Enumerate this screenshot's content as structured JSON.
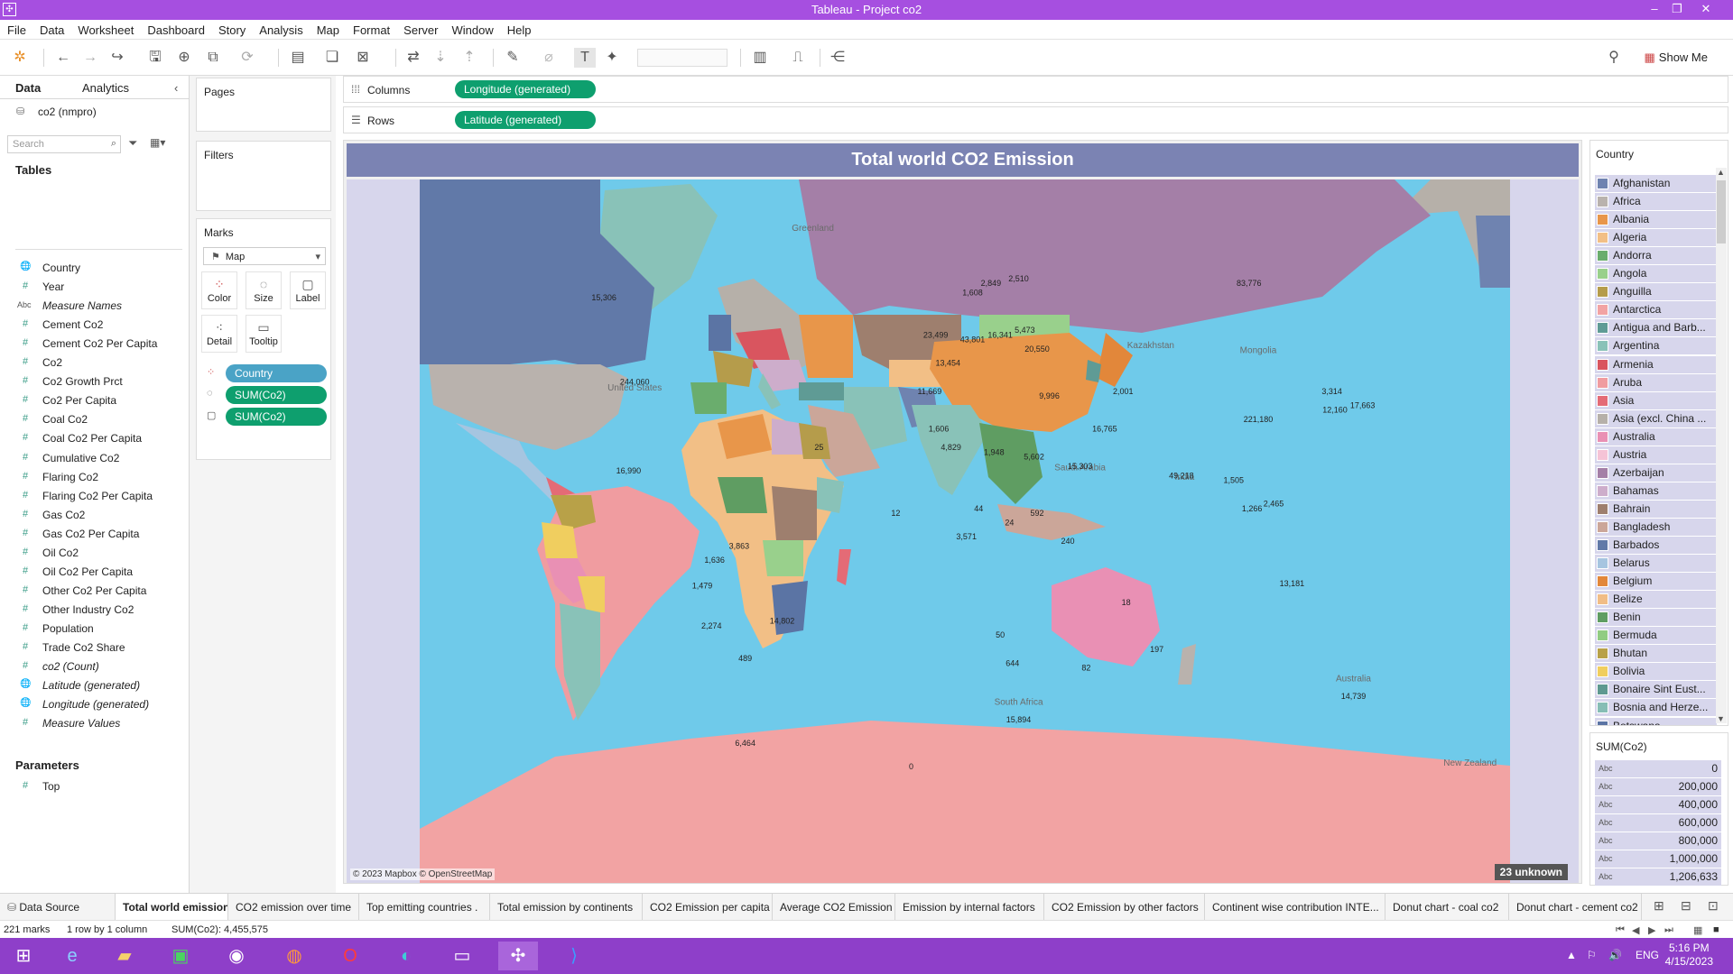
{
  "window": {
    "title": "Tableau - Project co2"
  },
  "menu": [
    "File",
    "Data",
    "Worksheet",
    "Dashboard",
    "Story",
    "Analysis",
    "Map",
    "Format",
    "Server",
    "Window",
    "Help"
  ],
  "toolbar": {
    "show_me": "Show Me"
  },
  "left_panel": {
    "tabs": [
      "Data",
      "Analytics"
    ],
    "datasource": "co2 (nmpro)",
    "search_placeholder": "Search",
    "tables_heading": "Tables",
    "fields": [
      {
        "name": "Country",
        "type": "geo",
        "italic": false
      },
      {
        "name": "Year",
        "type": "num",
        "italic": false
      },
      {
        "name": "Measure Names",
        "type": "abc",
        "italic": true
      },
      {
        "name": "Cement Co2",
        "type": "num",
        "italic": false
      },
      {
        "name": "Cement Co2 Per Capita",
        "type": "num",
        "italic": false
      },
      {
        "name": "Co2",
        "type": "num",
        "italic": false
      },
      {
        "name": "Co2 Growth Prct",
        "type": "num",
        "italic": false
      },
      {
        "name": "Co2 Per Capita",
        "type": "num",
        "italic": false
      },
      {
        "name": "Coal Co2",
        "type": "num",
        "italic": false
      },
      {
        "name": "Coal Co2 Per Capita",
        "type": "num",
        "italic": false
      },
      {
        "name": "Cumulative Co2",
        "type": "num",
        "italic": false
      },
      {
        "name": "Flaring Co2",
        "type": "num",
        "italic": false
      },
      {
        "name": "Flaring Co2 Per Capita",
        "type": "num",
        "italic": false
      },
      {
        "name": "Gas Co2",
        "type": "num",
        "italic": false
      },
      {
        "name": "Gas Co2 Per Capita",
        "type": "num",
        "italic": false
      },
      {
        "name": "Oil Co2",
        "type": "num",
        "italic": false
      },
      {
        "name": "Oil Co2 Per Capita",
        "type": "num",
        "italic": false
      },
      {
        "name": "Other Co2 Per Capita",
        "type": "num",
        "italic": false
      },
      {
        "name": "Other Industry Co2",
        "type": "num",
        "italic": false
      },
      {
        "name": "Population",
        "type": "num",
        "italic": false
      },
      {
        "name": "Trade Co2 Share",
        "type": "num",
        "italic": false
      },
      {
        "name": "co2 (Count)",
        "type": "num",
        "italic": true
      },
      {
        "name": "Latitude (generated)",
        "type": "geo",
        "italic": true
      },
      {
        "name": "Longitude (generated)",
        "type": "geo",
        "italic": true
      },
      {
        "name": "Measure Values",
        "type": "num",
        "italic": true
      }
    ],
    "parameters_heading": "Parameters",
    "parameters": [
      "Top"
    ]
  },
  "cards": {
    "pages": "Pages",
    "filters": "Filters",
    "marks": "Marks",
    "mark_type": "Map",
    "mark_buttons": [
      "Color",
      "Size",
      "Label",
      "Detail",
      "Tooltip"
    ],
    "mark_pills": [
      "Country",
      "SUM(Co2)",
      "SUM(Co2)"
    ]
  },
  "shelves": {
    "columns_label": "Columns",
    "columns_pill": "Longitude (generated)",
    "rows_label": "Rows",
    "rows_pill": "Latitude (generated)"
  },
  "viz": {
    "title": "Total world CO2 Emission",
    "attribution": "© 2023 Mapbox © OpenStreetMap",
    "unknown": "23 unknown",
    "map_labels": [
      {
        "t": "244,060",
        "lon": -100,
        "lat": 42
      },
      {
        "t": "15,306",
        "lon": -110,
        "lat": 60
      },
      {
        "t": "83,776",
        "lon": 100,
        "lat": 63
      },
      {
        "t": "221,180",
        "lon": 103,
        "lat": 34
      },
      {
        "t": "14,739",
        "lon": 134,
        "lat": -25
      },
      {
        "t": "14,802",
        "lon": -52,
        "lat": -9
      },
      {
        "t": "16,990",
        "lon": -102,
        "lat": 23
      },
      {
        "t": "49,218",
        "lon": 78,
        "lat": 22
      },
      {
        "t": "17,663",
        "lon": 137,
        "lat": 37
      },
      {
        "t": "12,160",
        "lon": 128,
        "lat": 36
      },
      {
        "t": "15,303",
        "lon": 45,
        "lat": 24
      },
      {
        "t": "16,765",
        "lon": 53,
        "lat": 32
      },
      {
        "t": "43,801",
        "lon": 10,
        "lat": 51
      },
      {
        "t": "20,550",
        "lon": 31,
        "lat": 49
      },
      {
        "t": "23,499",
        "lon": -2,
        "lat": 52
      },
      {
        "t": "13,454",
        "lon": 2,
        "lat": 46
      },
      {
        "t": "16,341",
        "lon": 19,
        "lat": 52
      },
      {
        "t": "11,669",
        "lon": -4,
        "lat": 40
      },
      {
        "t": "4,829",
        "lon": 3,
        "lat": 28
      },
      {
        "t": "1,948",
        "lon": 17,
        "lat": 27
      },
      {
        "t": "5,602",
        "lon": 30,
        "lat": 26
      },
      {
        "t": "3,571",
        "lon": 8,
        "lat": 9
      },
      {
        "t": "15,894",
        "lon": 25,
        "lat": -30
      },
      {
        "t": "6,464",
        "lon": -64,
        "lat": -35
      },
      {
        "t": "2,274",
        "lon": -75,
        "lat": -10
      },
      {
        "t": "1,479",
        "lon": -78,
        "lat": -1.5
      },
      {
        "t": "13,181",
        "lon": 114,
        "lat": -1
      },
      {
        "t": "3,863",
        "lon": -66,
        "lat": 7
      },
      {
        "t": "1,636",
        "lon": -74,
        "lat": 4
      },
      {
        "t": "489",
        "lon": -64,
        "lat": -17
      },
      {
        "t": "1,606",
        "lon": -1,
        "lat": 32
      },
      {
        "t": "9,996",
        "lon": 35,
        "lat": 39
      },
      {
        "t": "2,001",
        "lon": 59,
        "lat": 40
      },
      {
        "t": "3,314",
        "lon": 127,
        "lat": 40
      },
      {
        "t": "2,510",
        "lon": 25,
        "lat": 64
      },
      {
        "t": "2,849",
        "lon": 16,
        "lat": 63
      },
      {
        "t": "1,608",
        "lon": 10,
        "lat": 61
      },
      {
        "t": "1,266",
        "lon": 101,
        "lat": 15
      },
      {
        "t": "2,465",
        "lon": 108,
        "lat": 16
      },
      {
        "t": "1,505",
        "lon": 95,
        "lat": 21
      },
      {
        "t": "5,473",
        "lon": 27,
        "lat": 53
      },
      {
        "t": "50",
        "lon": 19,
        "lat": -12
      },
      {
        "t": "644",
        "lon": 23,
        "lat": -18
      },
      {
        "t": "592",
        "lon": 31,
        "lat": 14
      },
      {
        "t": "240",
        "lon": 41,
        "lat": 8
      },
      {
        "t": "24",
        "lon": 22,
        "lat": 12
      },
      {
        "t": "44",
        "lon": 12,
        "lat": 15
      },
      {
        "t": "25",
        "lon": -40,
        "lat": 28
      },
      {
        "t": "18",
        "lon": 60,
        "lat": -5
      },
      {
        "t": "197",
        "lon": 70,
        "lat": -15
      },
      {
        "t": "82",
        "lon": 47,
        "lat": -19
      },
      {
        "t": "0",
        "lon": -10,
        "lat": -40
      },
      {
        "t": "12",
        "lon": -15,
        "lat": 14
      }
    ],
    "map_names": [
      {
        "t": "Greenland",
        "lon": -42,
        "lat": 73
      },
      {
        "t": "United States",
        "lon": -100,
        "lat": 39
      },
      {
        "t": "Kazakhstan",
        "lon": 68,
        "lat": 48
      },
      {
        "t": "Mongolia",
        "lon": 103,
        "lat": 47
      },
      {
        "t": "Australia",
        "lon": 134,
        "lat": -23
      },
      {
        "t": "New Zealand",
        "lon": 172,
        "lat": -41
      },
      {
        "t": "Saudi Arabia",
        "lon": 45,
        "lat": 22
      },
      {
        "t": "India",
        "lon": 79,
        "lat": 20
      },
      {
        "t": "South Africa",
        "lon": 25,
        "lat": -28
      }
    ]
  },
  "legend_country": {
    "title": "Country",
    "items": [
      {
        "name": "Afghanistan",
        "color": "#6f83b0"
      },
      {
        "name": "Africa",
        "color": "#b9b2ad"
      },
      {
        "name": "Albania",
        "color": "#e8964a"
      },
      {
        "name": "Algeria",
        "color": "#f2bf86"
      },
      {
        "name": "Andorra",
        "color": "#6aad6d"
      },
      {
        "name": "Angola",
        "color": "#99d08c"
      },
      {
        "name": "Anguilla",
        "color": "#b59c4b"
      },
      {
        "name": "Antarctica",
        "color": "#f2a3a3"
      },
      {
        "name": "Antigua and Barb...",
        "color": "#5f9b95"
      },
      {
        "name": "Argentina",
        "color": "#89c2b8"
      },
      {
        "name": "Armenia",
        "color": "#d9555f"
      },
      {
        "name": "Aruba",
        "color": "#f09ca0"
      },
      {
        "name": "Asia",
        "color": "#e46b76"
      },
      {
        "name": "Asia (excl. China ...",
        "color": "#b6b0a9"
      },
      {
        "name": "Australia",
        "color": "#e990b4"
      },
      {
        "name": "Austria",
        "color": "#f5c3d6"
      },
      {
        "name": "Azerbaijan",
        "color": "#a47fa7"
      },
      {
        "name": "Bahamas",
        "color": "#cdadcb"
      },
      {
        "name": "Bahrain",
        "color": "#9e7f6e"
      },
      {
        "name": "Bangladesh",
        "color": "#cba699"
      },
      {
        "name": "Barbados",
        "color": "#6179a8"
      },
      {
        "name": "Belarus",
        "color": "#a6c5e0"
      },
      {
        "name": "Belgium",
        "color": "#e2873a"
      },
      {
        "name": "Belize",
        "color": "#f1bd86"
      },
      {
        "name": "Benin",
        "color": "#5f9d62"
      },
      {
        "name": "Bermuda",
        "color": "#91cc82"
      },
      {
        "name": "Bhutan",
        "color": "#b8a148"
      },
      {
        "name": "Bolivia",
        "color": "#f0ce5f"
      },
      {
        "name": "Bonaire Sint Eust...",
        "color": "#5e9990"
      },
      {
        "name": "Bosnia and Herze...",
        "color": "#86bdb5"
      },
      {
        "name": "Botswana",
        "color": "#5b74a4"
      }
    ]
  },
  "legend_size": {
    "title": "SUM(Co2)",
    "items": [
      "0",
      "200,000",
      "400,000",
      "600,000",
      "800,000",
      "1,000,000",
      "1,206,633"
    ]
  },
  "sheets": [
    {
      "name": "Data Source",
      "w": 128,
      "active": false
    },
    {
      "name": "Total world emission",
      "w": 125,
      "active": true
    },
    {
      "name": "CO2 emission over time",
      "w": 145,
      "active": false
    },
    {
      "name": "Top emitting countries .",
      "w": 145,
      "active": false
    },
    {
      "name": "Total emission by continents",
      "w": 169,
      "active": false
    },
    {
      "name": "CO2 Emission per capita",
      "w": 144,
      "active": false
    },
    {
      "name": "Average CO2 Emission",
      "w": 136,
      "active": false
    },
    {
      "name": "Emission by internal factors",
      "w": 165,
      "active": false
    },
    {
      "name": "CO2 Emission by other factors",
      "w": 178,
      "active": false
    },
    {
      "name": "Continent wise contribution INTE...",
      "w": 200,
      "active": false
    },
    {
      "name": "Donut chart - coal co2",
      "w": 137,
      "active": false
    },
    {
      "name": "Donut chart - cement co2",
      "w": 147,
      "active": false
    }
  ],
  "status": {
    "marks": "221 marks",
    "rows": "1 row by 1 column",
    "sum": "SUM(Co2): 4,455,575"
  },
  "taskbar": {
    "lang": "ENG",
    "time": "5:16 PM",
    "date": "4/15/2023"
  }
}
